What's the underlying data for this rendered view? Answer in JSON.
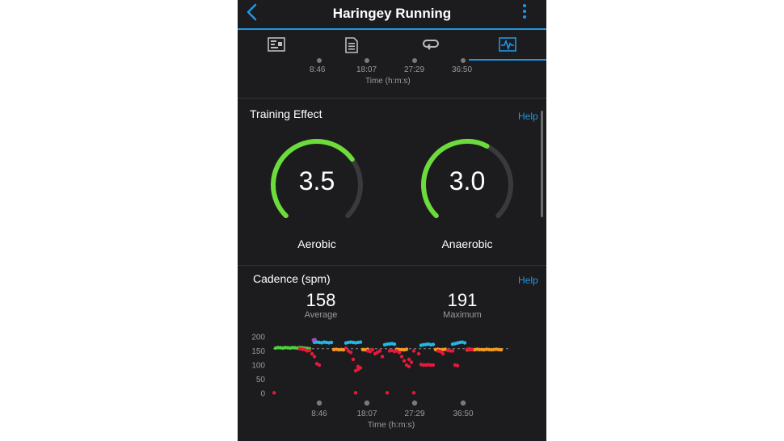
{
  "header": {
    "title": "Haringey Running",
    "back_icon": "chevron-left-icon",
    "menu_icon": "kebab-menu-icon"
  },
  "tabs": [
    {
      "icon": "stats-icon"
    },
    {
      "icon": "details-list-icon"
    },
    {
      "icon": "laps-icon"
    },
    {
      "icon": "charts-icon",
      "active": true
    }
  ],
  "top_axis": {
    "ticks": [
      "8:46",
      "18:07",
      "27:29",
      "36:50"
    ],
    "label": "Time (h:m:s)"
  },
  "training_effect": {
    "title": "Training Effect",
    "help": "Help",
    "aerobic": {
      "value": "3.5",
      "label": "Aerobic",
      "fraction": 0.7
    },
    "anaerobic": {
      "value": "3.0",
      "label": "Anaerobic",
      "fraction": 0.6
    }
  },
  "cadence": {
    "title": "Cadence (spm)",
    "help": "Help",
    "average": {
      "value": "158",
      "label": "Average"
    },
    "maximum": {
      "value": "191",
      "label": "Maximum"
    }
  },
  "chart_data": {
    "type": "scatter",
    "title": "Cadence (spm)",
    "xlabel": "Time (h:m:s)",
    "ylabel": "",
    "x_ticks": [
      "8:46",
      "18:07",
      "27:29",
      "36:50"
    ],
    "y_ticks": [
      200,
      150,
      100,
      50,
      0
    ],
    "ylim": [
      0,
      200
    ],
    "xlim_minutes": [
      0,
      49
    ],
    "average_line": 158,
    "colors": {
      "blue": "#23b7e5",
      "green": "#4cd23a",
      "orange": "#f39a22",
      "red": "#e8193c",
      "purple": "#a64ac9"
    },
    "series": [
      {
        "color": "green",
        "points": [
          [
            0.5,
            160
          ],
          [
            1,
            162
          ],
          [
            1.5,
            161
          ],
          [
            2,
            160
          ],
          [
            2.5,
            162
          ],
          [
            3,
            161
          ],
          [
            3.5,
            160
          ],
          [
            4,
            162
          ],
          [
            4.5,
            161
          ],
          [
            5,
            160
          ],
          [
            5.5,
            162
          ],
          [
            6,
            161
          ],
          [
            6.5,
            160
          ],
          [
            7,
            159
          ],
          [
            7.5,
            158
          ]
        ]
      },
      {
        "color": "blue",
        "points": [
          [
            8.5,
            180
          ],
          [
            9,
            181
          ],
          [
            9.5,
            180
          ],
          [
            10,
            179
          ],
          [
            10.5,
            181
          ],
          [
            11,
            180
          ],
          [
            11.5,
            179
          ],
          [
            12,
            180
          ],
          [
            15,
            178
          ],
          [
            15.5,
            180
          ],
          [
            16,
            181
          ],
          [
            16.5,
            180
          ],
          [
            17,
            179
          ],
          [
            17.5,
            180
          ],
          [
            18,
            181
          ],
          [
            23,
            172
          ],
          [
            23.5,
            174
          ],
          [
            24,
            175
          ],
          [
            24.5,
            176
          ],
          [
            25,
            174
          ],
          [
            30.5,
            170
          ],
          [
            31,
            172
          ],
          [
            31.5,
            173
          ],
          [
            32,
            174
          ],
          [
            32.5,
            172
          ],
          [
            33,
            173
          ],
          [
            37,
            174
          ],
          [
            37.5,
            176
          ],
          [
            38,
            178
          ],
          [
            38.5,
            180
          ],
          [
            39,
            181
          ],
          [
            39.5,
            179
          ]
        ]
      },
      {
        "color": "orange",
        "points": [
          [
            12.5,
            155
          ],
          [
            13,
            156
          ],
          [
            13.5,
            154
          ],
          [
            14,
            155
          ],
          [
            14.5,
            154
          ],
          [
            18.5,
            155
          ],
          [
            19,
            154
          ],
          [
            19.5,
            156
          ],
          [
            25.5,
            156
          ],
          [
            26,
            155
          ],
          [
            26.5,
            155
          ],
          [
            27,
            154
          ],
          [
            27.5,
            156
          ],
          [
            33.5,
            155
          ],
          [
            34,
            156
          ],
          [
            34.5,
            154
          ],
          [
            35,
            155
          ],
          [
            35.5,
            156
          ],
          [
            40,
            154
          ],
          [
            40.5,
            156
          ],
          [
            41,
            155
          ],
          [
            41.5,
            154
          ],
          [
            42,
            156
          ],
          [
            42.5,
            155
          ],
          [
            43,
            155
          ],
          [
            43.5,
            154
          ],
          [
            44,
            156
          ],
          [
            44.5,
            155
          ],
          [
            45,
            154
          ],
          [
            45.5,
            155
          ],
          [
            46,
            156
          ],
          [
            46.5,
            155
          ],
          [
            47,
            154
          ]
        ]
      },
      {
        "color": "red",
        "points": [
          [
            0.2,
            2
          ],
          [
            5.5,
            158
          ],
          [
            6,
            156
          ],
          [
            6.5,
            155
          ],
          [
            7,
            150
          ],
          [
            7.5,
            152
          ],
          [
            8,
            140
          ],
          [
            8.5,
            130
          ],
          [
            9,
            105
          ],
          [
            9.5,
            100
          ],
          [
            15,
            160
          ],
          [
            15.5,
            150
          ],
          [
            16,
            145
          ],
          [
            16.5,
            120
          ],
          [
            17,
            80
          ],
          [
            17.5,
            85
          ],
          [
            18,
            90
          ],
          [
            17.5,
            95
          ],
          [
            17,
            2
          ],
          [
            19.5,
            150
          ],
          [
            20,
            148
          ],
          [
            20.5,
            155
          ],
          [
            21,
            140
          ],
          [
            21.5,
            145
          ],
          [
            22,
            150
          ],
          [
            22.5,
            130
          ],
          [
            23.5,
            2
          ],
          [
            24,
            150
          ],
          [
            24.5,
            152
          ],
          [
            25,
            148
          ],
          [
            25.5,
            150
          ],
          [
            26,
            145
          ],
          [
            26.5,
            130
          ],
          [
            27,
            115
          ],
          [
            27.5,
            100
          ],
          [
            28,
            95
          ],
          [
            28.5,
            110
          ],
          [
            28,
            120
          ],
          [
            29,
            2
          ],
          [
            29,
            150
          ],
          [
            30,
            140
          ],
          [
            30.5,
            102
          ],
          [
            31,
            100
          ],
          [
            31.5,
            100
          ],
          [
            32,
            101
          ],
          [
            32.5,
            100
          ],
          [
            33,
            100
          ],
          [
            34,
            150
          ],
          [
            34.5,
            148
          ],
          [
            35,
            140
          ],
          [
            36,
            152
          ],
          [
            36.5,
            150
          ],
          [
            37,
            150
          ],
          [
            37.5,
            100
          ],
          [
            38,
            98
          ],
          [
            40,
            156
          ],
          [
            40.5,
            154
          ],
          [
            41,
            155
          ]
        ]
      },
      {
        "color": "purple",
        "points": [
          [
            8.3,
            188
          ],
          [
            8.6,
            190
          ]
        ]
      }
    ]
  }
}
